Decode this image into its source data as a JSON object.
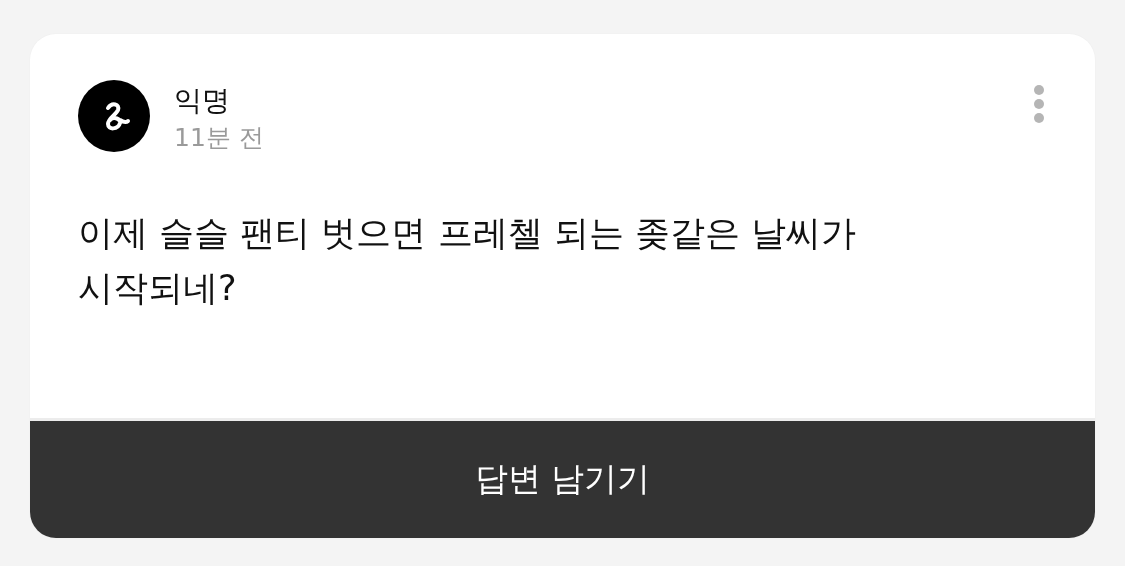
{
  "post": {
    "author": "익명",
    "time": "11분 전",
    "body": "이제 슬슬 팬티 벗으면 프레첼 되는 좆같은 날씨가 시작되네?"
  },
  "reply_button": {
    "label": "답변 남기기"
  }
}
